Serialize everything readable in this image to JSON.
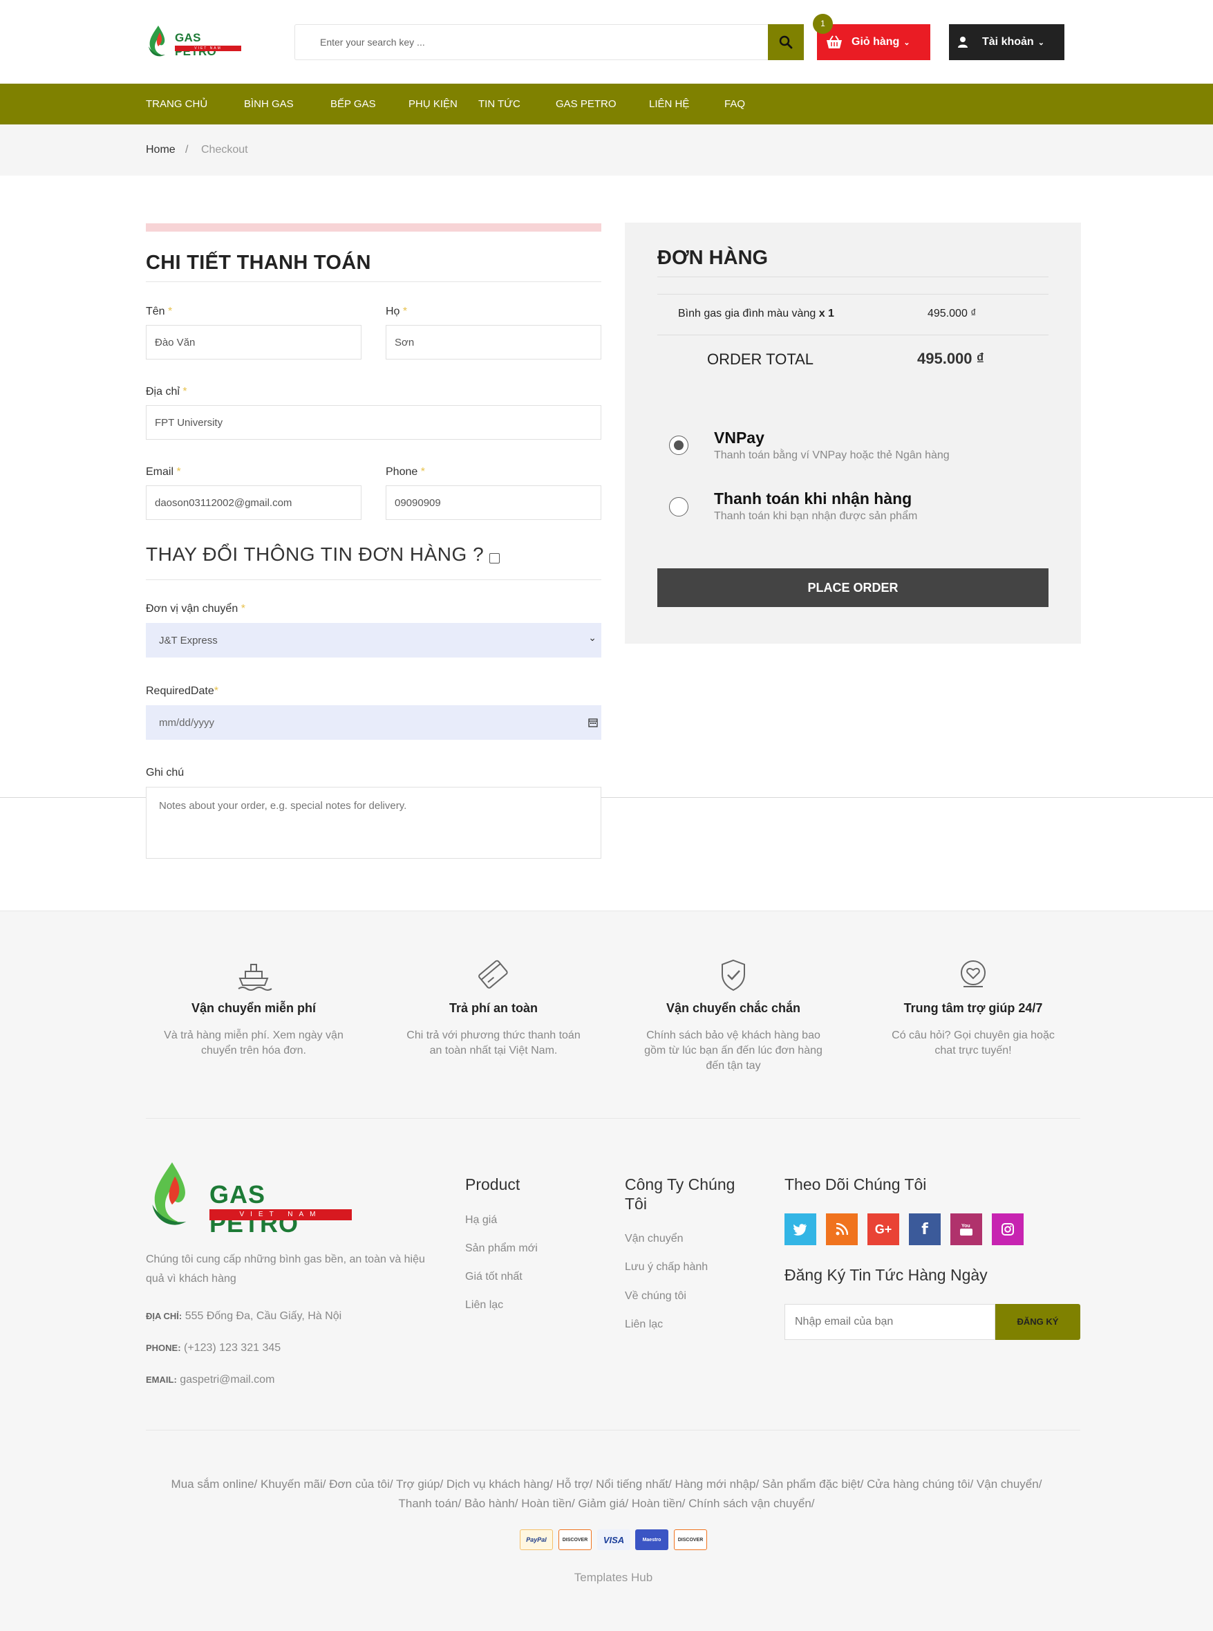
{
  "header": {
    "logo_text": "GAS PETRO",
    "logo_sub": "VIET NAM",
    "search_placeholder": "Enter your search key ...",
    "cart_count": "1",
    "cart_label": "Giỏ hàng",
    "account_label": "Tài khoản"
  },
  "nav": [
    "TRANG CHỦ",
    "BÌNH GAS",
    "BẾP GAS",
    "PHỤ KIỆN",
    "TIN TỨC",
    "GAS PETRO",
    "LIÊN HỆ",
    "FAQ"
  ],
  "breadcrumb": {
    "home": "Home",
    "sep": "/",
    "current": "Checkout"
  },
  "billing": {
    "title": "CHI TIẾT THANH TOÁN",
    "first_name_label": "Tên",
    "first_name_value": "Đào Văn",
    "last_name_label": "Họ",
    "last_name_value": "Sơn",
    "address_label": "Địa chỉ",
    "address_value": "FPT University",
    "email_label": "Email",
    "email_value": "daoson03112002@gmail.com",
    "phone_label": "Phone",
    "phone_value": "09090909",
    "change_title": "THAY ĐỔI THÔNG TIN ĐƠN HÀNG ?",
    "shipper_label": "Đơn vị vận chuyển",
    "shipper_value": "J&T Express",
    "date_label": "RequiredDate",
    "date_placeholder": "mm/dd/yyyy",
    "notes_label": "Ghi chú",
    "notes_placeholder": "Notes about your order, e.g. special notes for delivery.",
    "required_mark": "*"
  },
  "order": {
    "title": "ĐƠN HÀNG",
    "item_name": "Bình gas gia đình màu vàng",
    "item_qty": "x 1",
    "item_price": "495.000 ₫",
    "total_label": "ORDER TOTAL",
    "total_value": "495.000 ₫",
    "payments": [
      {
        "name": "VNPay",
        "desc": "Thanh toán bằng ví VNPay hoặc thẻ Ngân hàng",
        "selected": true
      },
      {
        "name": "Thanh toán khi nhận hàng",
        "desc": "Thanh toán khi bạn nhận được sản phẩm",
        "selected": false
      }
    ],
    "place_order": "PLACE ORDER"
  },
  "features": [
    {
      "icon": "ship-icon",
      "title": "Vận chuyển miễn phí",
      "desc": "Và trả hàng miễn phí. Xem ngày vận chuyển trên hóa đơn."
    },
    {
      "icon": "credit-card-icon",
      "title": "Trả phí an toàn",
      "desc": "Chi trả với phương thức thanh toán an toàn nhất tại Việt Nam."
    },
    {
      "icon": "shield-check-icon",
      "title": "Vận chuyển chắc chắn",
      "desc": "Chính sách bảo vệ khách hàng bao gồm từ lúc bạn ấn đến lúc đơn hàng đến tận tay"
    },
    {
      "icon": "support-heart-icon",
      "title": "Trung tâm trợ giúp 24/7",
      "desc": "Có câu hỏi? Gọi chuyên gia hoặc chat trực tuyến!"
    }
  ],
  "footer": {
    "about": "Chúng tôi cung cấp những bình gas bền, an toàn và hiệu quả vì khách hàng",
    "address_label": "ĐỊA CHỈ:",
    "address": "555 Đống Đa, Cầu Giấy, Hà Nội",
    "phone_label": "PHONE:",
    "phone": "(+123) 123 321 345",
    "email_label": "EMAIL:",
    "email": "gaspetri@mail.com",
    "product_title": "Product",
    "product_links": [
      "Hạ giá",
      "Sản phẩm mới",
      "Giá tốt nhất",
      "Liên lạc"
    ],
    "company_title": "Công Ty Chúng Tôi",
    "company_links": [
      "Vận chuyển",
      "Lưu ý chấp hành",
      "Về chúng tôi",
      "Liên lạc"
    ],
    "follow_title": "Theo Dõi Chúng Tôi",
    "social": [
      {
        "name": "twitter-icon",
        "glyph": "🐦",
        "color": "#33b5e5"
      },
      {
        "name": "rss-icon",
        "glyph": "◉",
        "color": "#f0731e"
      },
      {
        "name": "google-plus-icon",
        "glyph": "G+",
        "color": "#e94335"
      },
      {
        "name": "facebook-icon",
        "glyph": "f",
        "color": "#3b5a9a"
      },
      {
        "name": "youtube-icon",
        "glyph": "▶",
        "color": "#b0326c"
      },
      {
        "name": "instagram-icon",
        "glyph": "◎",
        "color": "#c724b1"
      }
    ],
    "newsletter_title": "Đăng Ký Tin Tức Hàng Ngày",
    "newsletter_placeholder": "Nhập email của bạn",
    "newsletter_button": "ĐĂNG KÝ",
    "bottom_links": "Mua sắm online/ Khuyến mãi/ Đơn của tôi/ Trợ giúp/ Dịch vụ khách hàng/ Hỗ trợ/ Nổi tiếng nhất/ Hàng mới nhập/ Sản phẩm đặc biệt/ Cửa hàng chúng tôi/ Vận chuyển/ Thanh toán/ Bảo hành/ Hoàn tiền/ Giảm giá/ Hoàn tiền/ Chính sách vận chuyển/",
    "payment_cards": [
      "PayPal",
      "DISCOVER",
      "VISA",
      "Maestro",
      "DISCOVER"
    ],
    "credit": "Templates Hub"
  }
}
